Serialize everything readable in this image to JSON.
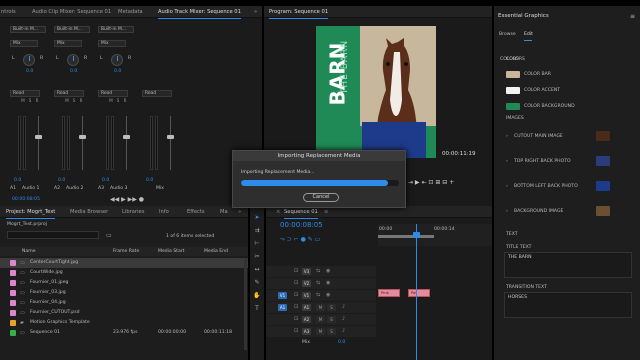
{
  "mixer_tabs": [
    "ntrols",
    "Audio Clip Mixer: Sequence 01",
    "Metadata",
    "Audio Track Mixer: Sequence 01"
  ],
  "mixer": {
    "menu": "»",
    "channels": [
      {
        "input": "Built-in M...",
        "mix": "Mix",
        "pan": "0.0",
        "auto": "Read",
        "vol": "0.0",
        "id": "A1",
        "name": "Audio 1"
      },
      {
        "input": "Built-in M...",
        "mix": "Mix",
        "pan": "0.0",
        "auto": "Read",
        "vol": "0.0",
        "id": "A2",
        "name": "Audio 2"
      },
      {
        "input": "Built-in M...",
        "mix": "Mix",
        "pan": "0.0",
        "auto": "Read",
        "vol": "0.0",
        "id": "A3",
        "name": "Audio 3"
      },
      {
        "input": "",
        "mix": "",
        "pan": "",
        "auto": "Read",
        "vol": "0.0",
        "id": "",
        "name": "Mix"
      }
    ],
    "l": "L",
    "r": "R",
    "btns": [
      "M",
      "S",
      "R"
    ],
    "timecode": "00:00:08:05"
  },
  "program": {
    "tab": "Program: Sequence 01",
    "text1": "BARN",
    "text2": "THE BARN",
    "timecode": "00:00:11:19"
  },
  "eg": {
    "title": "Essential Graphics",
    "menu": "≡",
    "tabs": [
      "Browse",
      "Edit"
    ],
    "colors_label": "COLORS",
    "colors": [
      {
        "name": "COLOR BAR",
        "hex": "#c8b59a"
      },
      {
        "name": "COLOR ACCENT",
        "hex": "#f2f2f2"
      },
      {
        "name": "COLOR BACKGROUND",
        "hex": "#1f8a55"
      }
    ],
    "images_label": "IMAGES",
    "images": [
      {
        "name": "CUTOUT MAIN IMAGE"
      },
      {
        "name": "TOP RIGHT BACK PHOTO"
      },
      {
        "name": "BOTTOM LEFT BACK PHOTO"
      },
      {
        "name": "BACKGROUND IMAGE"
      }
    ],
    "text_label": "TEXT",
    "title_label": "TITLE TEXT",
    "title_value": "THE BARN",
    "trans_label": "TRANSITION TEXT",
    "trans_value": "HORSES"
  },
  "dialog": {
    "title": "Importing Replacement Media",
    "message": "Importing Replacement Media...",
    "cancel": "Cancel",
    "progress": 0.93
  },
  "project": {
    "tabs": [
      "Project: Mogrt_Text",
      "Media Browser",
      "Libraries",
      "Info",
      "Effects",
      "Ma"
    ],
    "menu": "»",
    "file": "Mogrt_Text.prproj",
    "selected": "1 of 6 items selected",
    "columns": [
      "Name",
      "Frame Rate",
      "Media Start",
      "Media End"
    ],
    "rows": [
      {
        "name": "CenterCourtTight.jpg",
        "fr": "",
        "start": "",
        "end": "",
        "color": "#e084cf"
      },
      {
        "name": "CourtWide.jpg",
        "fr": "",
        "start": "",
        "end": "",
        "color": "#e084cf"
      },
      {
        "name": "Fournier_01.jpeg",
        "fr": "",
        "start": "",
        "end": "",
        "color": "#e084cf"
      },
      {
        "name": "Fournier_03.jpg",
        "fr": "",
        "start": "",
        "end": "",
        "color": "#e084cf"
      },
      {
        "name": "Fournier_04.jpg",
        "fr": "",
        "start": "",
        "end": "",
        "color": "#e084cf"
      },
      {
        "name": "Fournier_CUTOUT.psd",
        "fr": "",
        "start": "",
        "end": "",
        "color": "#e084cf"
      },
      {
        "name": "Motion Graphics Template",
        "fr": "",
        "start": "",
        "end": "",
        "color": "#e6a12a"
      },
      {
        "name": "Sequence 01",
        "fr": "23.976 fps",
        "start": "00:00:00:00",
        "end": "00:00:11:18",
        "color": "#35b04f"
      }
    ]
  },
  "timeline": {
    "tab": "Sequence 01",
    "menu": "≡",
    "timecode": "00:00:08:05",
    "ruler": [
      "00:00",
      "00:00:14"
    ],
    "tracks": [
      {
        "id": "V3"
      },
      {
        "id": "V2"
      },
      {
        "id": "V1",
        "src": "V1"
      },
      {
        "id": "A1",
        "src": "A1"
      },
      {
        "id": "A2"
      },
      {
        "id": "A3"
      }
    ],
    "mix_label": "Mix",
    "mix_value": "0.0",
    "clip1": "Pink",
    "clip2": "Pat"
  }
}
